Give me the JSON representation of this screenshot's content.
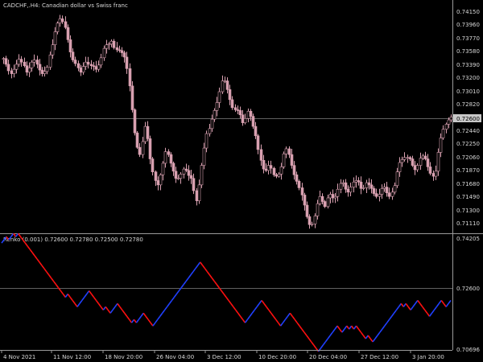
{
  "main_title": "CADCHF,.H4:  Canadian dollar vs Swiss franc",
  "indicator_title": "Renko (0.001) 0.72600 0.72780 0.72500 0.72780",
  "main_price_labels": [
    "0.74150",
    "0.73960",
    "0.73770",
    "0.73580",
    "0.73390",
    "0.73200",
    "0.73010",
    "0.72820",
    "0.72630",
    "0.72440",
    "0.72250",
    "0.72060",
    "0.71870",
    "0.71680",
    "0.71490",
    "0.71300",
    "0.71110"
  ],
  "current_price_tag": "0.72600",
  "indicator_price_labels": [
    "0.74205",
    "0.72600",
    "0.70696"
  ],
  "date_labels": [
    "4 Nov 2021",
    "11 Nov 12:00",
    "18 Nov 20:00",
    "26 Nov 04:00",
    "3 Dec 12:00",
    "10 Dec 20:00",
    "20 Dec 04:00",
    "27 Dec 12:00",
    "3 Jan 20:00"
  ],
  "colors": {
    "background": "#000000",
    "candle": "#d8a0b0",
    "renko_up": "#2040ff",
    "renko_down": "#ff1010",
    "grid": "#606060",
    "text": "#d8d8d8"
  },
  "chart_data": [
    {
      "type": "candlestick",
      "title": "CADCHF,.H4:  Canadian dollar vs Swiss franc",
      "ylim": [
        0.7101,
        0.7424
      ],
      "current_price": 0.726,
      "close_series": [
        0.7343,
        0.7335,
        0.7326,
        0.7322,
        0.7328,
        0.7335,
        0.7342,
        0.7338,
        0.7333,
        0.7324,
        0.733,
        0.7338,
        0.7341,
        0.7335,
        0.7327,
        0.7322,
        0.7325,
        0.7331,
        0.7348,
        0.7362,
        0.738,
        0.7392,
        0.7398,
        0.7394,
        0.7386,
        0.7369,
        0.7352,
        0.7341,
        0.7336,
        0.733,
        0.7324,
        0.7332,
        0.7338,
        0.7335,
        0.7333,
        0.7332,
        0.7328,
        0.7334,
        0.7344,
        0.7357,
        0.7362,
        0.7363,
        0.7367,
        0.7358,
        0.7355,
        0.7354,
        0.7351,
        0.7345,
        0.7329,
        0.7305,
        0.7272,
        0.724,
        0.722,
        0.721,
        0.7228,
        0.7249,
        0.7232,
        0.7204,
        0.7186,
        0.7174,
        0.7168,
        0.7182,
        0.7198,
        0.7214,
        0.721,
        0.7198,
        0.7187,
        0.7177,
        0.7177,
        0.7183,
        0.719,
        0.7188,
        0.7181,
        0.7177,
        0.716,
        0.7146,
        0.7168,
        0.7195,
        0.7219,
        0.7239,
        0.7246,
        0.7259,
        0.7271,
        0.7282,
        0.7297,
        0.7312,
        0.7312,
        0.73,
        0.7286,
        0.7275,
        0.7272,
        0.7271,
        0.7265,
        0.7254,
        0.726,
        0.727,
        0.7263,
        0.7249,
        0.7236,
        0.7217,
        0.7202,
        0.719,
        0.7188,
        0.7195,
        0.7191,
        0.7182,
        0.718,
        0.7183,
        0.7193,
        0.7211,
        0.7218,
        0.721,
        0.7195,
        0.7182,
        0.7173,
        0.7164,
        0.7154,
        0.714,
        0.7124,
        0.7113,
        0.7114,
        0.7125,
        0.7142,
        0.7152,
        0.7145,
        0.7138,
        0.715,
        0.7155,
        0.715,
        0.7152,
        0.7162,
        0.717,
        0.7171,
        0.7162,
        0.7158,
        0.7165,
        0.7172,
        0.7174,
        0.7172,
        0.7163,
        0.7164,
        0.7171,
        0.7168,
        0.7163,
        0.7156,
        0.7152,
        0.7155,
        0.7163,
        0.7165,
        0.7157,
        0.7152,
        0.7158,
        0.7167,
        0.7186,
        0.7199,
        0.7203,
        0.7206,
        0.7206,
        0.7204,
        0.7195,
        0.7189,
        0.7195,
        0.7205,
        0.7208,
        0.7204,
        0.7193,
        0.7184,
        0.718,
        0.7187,
        0.7213,
        0.7233,
        0.7245,
        0.7252,
        0.7258,
        0.7262
      ]
    },
    {
      "type": "line",
      "title": "Renko (0.001) 0.72600 0.72780 0.72500 0.72780",
      "ylim": [
        0.70696,
        0.74205
      ],
      "brick_size": 0.001,
      "renko_bricks": [
        0.7405,
        0.7415,
        0.7425,
        0.7415,
        0.7425,
        0.7435,
        0.7425,
        0.7435,
        0.7425,
        0.7415,
        0.7405,
        0.7395,
        0.7385,
        0.7375,
        0.7365,
        0.7355,
        0.7345,
        0.7335,
        0.7325,
        0.7315,
        0.7305,
        0.7295,
        0.7285,
        0.7275,
        0.7265,
        0.7255,
        0.7245,
        0.7235,
        0.7245,
        0.7235,
        0.7225,
        0.7215,
        0.7205,
        0.7215,
        0.7225,
        0.7235,
        0.7245,
        0.7255,
        0.7245,
        0.7235,
        0.7225,
        0.7215,
        0.7205,
        0.7195,
        0.7205,
        0.7195,
        0.7185,
        0.7195,
        0.7205,
        0.7215,
        0.7205,
        0.7195,
        0.7185,
        0.7175,
        0.7165,
        0.7155,
        0.7165,
        0.7155,
        0.7165,
        0.7175,
        0.7185,
        0.7175,
        0.7165,
        0.7155,
        0.7145,
        0.7155,
        0.7165,
        0.7175,
        0.7185,
        0.7195,
        0.7205,
        0.7215,
        0.7225,
        0.7235,
        0.7245,
        0.7255,
        0.7265,
        0.7275,
        0.7285,
        0.7295,
        0.7305,
        0.7315,
        0.7325,
        0.7335,
        0.7345,
        0.7335,
        0.7325,
        0.7315,
        0.7305,
        0.7295,
        0.7285,
        0.7275,
        0.7265,
        0.7255,
        0.7245,
        0.7235,
        0.7225,
        0.7215,
        0.7205,
        0.7195,
        0.7185,
        0.7175,
        0.7165,
        0.7155,
        0.7165,
        0.7175,
        0.7185,
        0.7195,
        0.7205,
        0.7215,
        0.7225,
        0.7215,
        0.7205,
        0.7195,
        0.7185,
        0.7175,
        0.7165,
        0.7155,
        0.7145,
        0.7155,
        0.7165,
        0.7175,
        0.7185,
        0.7175,
        0.7165,
        0.7155,
        0.7145,
        0.7135,
        0.7125,
        0.7115,
        0.7105,
        0.7095,
        0.7085,
        0.7075,
        0.7065,
        0.7075,
        0.7085,
        0.7095,
        0.7105,
        0.7115,
        0.7125,
        0.7135,
        0.7145,
        0.7135,
        0.7125,
        0.7135,
        0.7145,
        0.7135,
        0.7145,
        0.7135,
        0.7145,
        0.7135,
        0.7125,
        0.7115,
        0.7105,
        0.7115,
        0.7105,
        0.7095,
        0.7105,
        0.7115,
        0.7125,
        0.7135,
        0.7145,
        0.7155,
        0.7165,
        0.7175,
        0.7185,
        0.7195,
        0.7205,
        0.7215,
        0.7205,
        0.7215,
        0.7205,
        0.7195,
        0.7205,
        0.7215,
        0.7225,
        0.7215,
        0.7205,
        0.7195,
        0.7185,
        0.7175,
        0.7185,
        0.7195,
        0.7205,
        0.7215,
        0.7225,
        0.7215,
        0.7205,
        0.7215,
        0.7225
      ]
    }
  ]
}
